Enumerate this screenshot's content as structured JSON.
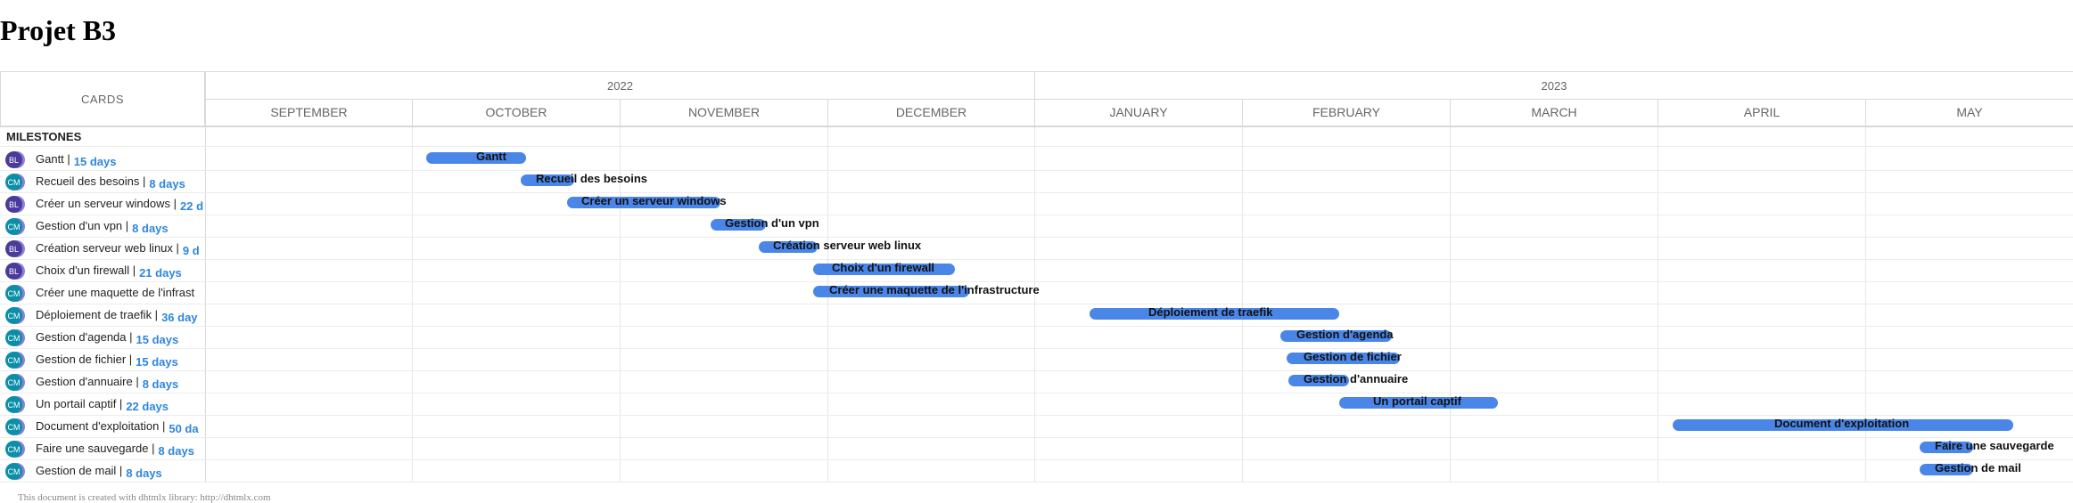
{
  "title": "Projet B3",
  "header": {
    "cards_label": "CARDS",
    "years": [
      "2022",
      "2023"
    ],
    "months": [
      "SEPTEMBER",
      "OCTOBER",
      "NOVEMBER",
      "DECEMBER",
      "JANUARY",
      "FEBRUARY",
      "MARCH",
      "APRIL",
      "MAY"
    ]
  },
  "milestones_label": "MILESTONES",
  "rows": [
    {
      "avatar": "BL",
      "name": "Gantt |",
      "days": "15 days",
      "bar_label": "Gantt"
    },
    {
      "avatar": "CM",
      "name": "Recueil des besoins |",
      "days": "8 days",
      "bar_label": "Recueil des besoins"
    },
    {
      "avatar": "BL",
      "name": "Créer un serveur windows |",
      "days": "22 d",
      "bar_label": "Créer un serveur windows"
    },
    {
      "avatar": "CM",
      "name": "Gestion d'un vpn |",
      "days": "8 days",
      "bar_label": "Gestion d'un vpn"
    },
    {
      "avatar": "BL",
      "name": "Création serveur web linux |",
      "days": "9 d",
      "bar_label": "Création serveur web linux"
    },
    {
      "avatar": "BL",
      "name": "Choix d'un firewall |",
      "days": "21 days",
      "bar_label": "Choix d'un firewall"
    },
    {
      "avatar": "CM",
      "name": "Créer une maquette de l'infrast",
      "days": "",
      "bar_label": "Créer une maquette de l'infrastructure"
    },
    {
      "avatar": "CM",
      "name": "Déploiement de traefik |",
      "days": "36 day",
      "bar_label": "Déploiement de traefik"
    },
    {
      "avatar": "CM",
      "name": "Gestion d'agenda |",
      "days": "15 days",
      "bar_label": "Gestion d'agenda"
    },
    {
      "avatar": "CM",
      "name": "Gestion de fichier |",
      "days": "15 days",
      "bar_label": "Gestion de fichier"
    },
    {
      "avatar": "CM",
      "name": "Gestion d'annuaire |",
      "days": "8 days",
      "bar_label": "Gestion d'annuaire"
    },
    {
      "avatar": "CM",
      "name": "Un portail captif |",
      "days": "22 days",
      "bar_label": "Un portail captif"
    },
    {
      "avatar": "CM",
      "name": "Document d'exploitation |",
      "days": "50 da",
      "bar_label": "Document d'exploitation"
    },
    {
      "avatar": "CM",
      "name": "Faire une sauvegarde |",
      "days": "8 days",
      "bar_label": "Faire une sauvegarde"
    },
    {
      "avatar": "CM",
      "name": "Gestion de mail |",
      "days": "8 days",
      "bar_label": "Gestion de mail"
    }
  ],
  "colors": {
    "bar": "#4a86e8",
    "days_text": "#2e86de",
    "avatar_cm": "#0b8fa8",
    "avatar_bl": "#4b3a9c"
  },
  "footer": "This document is created with dhtmlx library: http://dhtmlx.com"
}
